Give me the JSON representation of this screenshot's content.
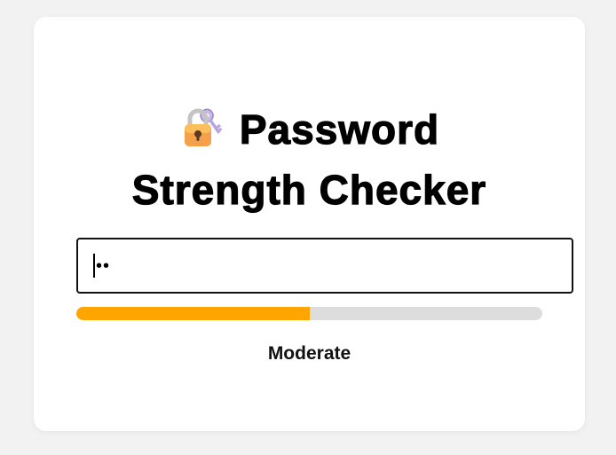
{
  "header": {
    "icon": "locked-with-key-icon",
    "title_line1": "Password",
    "title_line2": "Strength Checker"
  },
  "password_field": {
    "value": "••",
    "type": "password"
  },
  "strength_meter": {
    "level_fraction": 0.5,
    "fill_color": "#ffa500",
    "track_color": "#dddddd"
  },
  "strength": {
    "label": "Moderate"
  }
}
